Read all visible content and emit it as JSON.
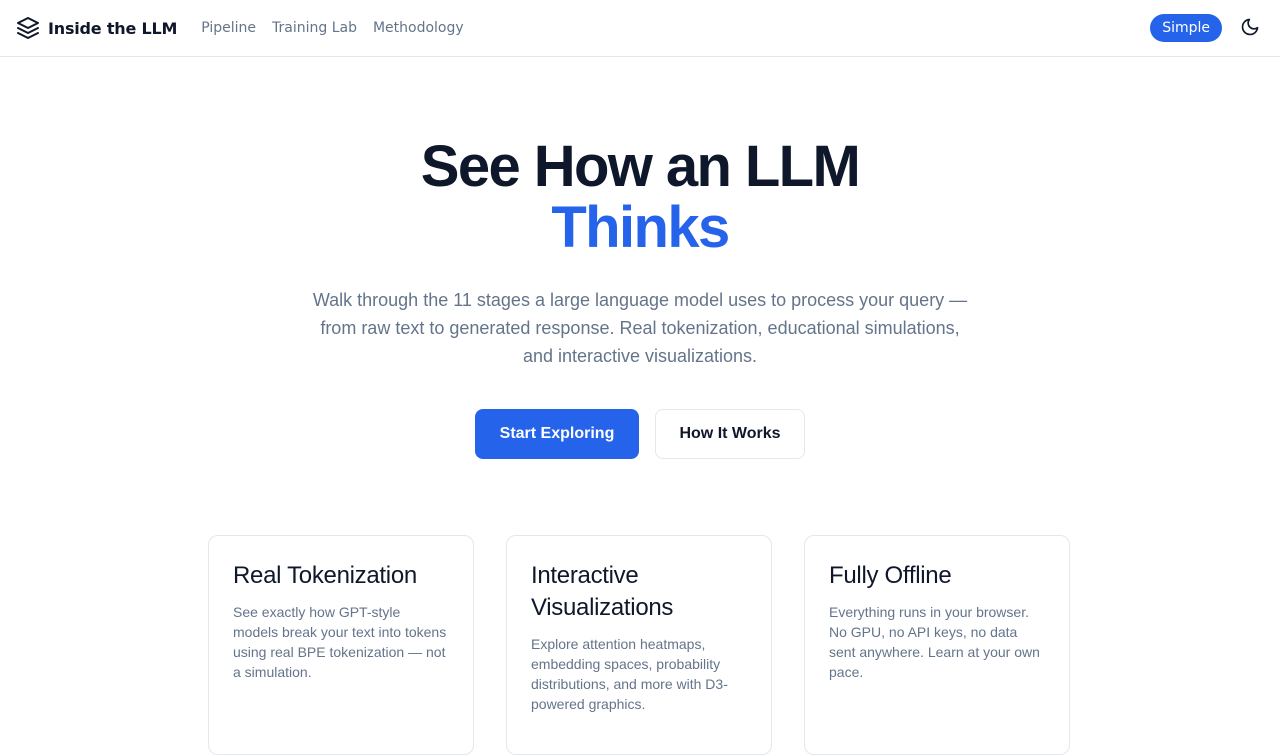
{
  "header": {
    "brand": "Inside the LLM",
    "brand_icon": "layers-icon",
    "nav": [
      {
        "label": "Pipeline"
      },
      {
        "label": "Training Lab"
      },
      {
        "label": "Methodology"
      }
    ],
    "mode_label": "Simple",
    "theme_icon": "moon-icon"
  },
  "hero": {
    "title_line1": "See How an LLM",
    "title_line2": "Thinks",
    "subtitle": "Walk through the 11 stages a large language model uses to process your query — from raw text to generated response. Real tokenization, educational simulations, and interactive visualizations.",
    "primary_cta": "Start Exploring",
    "secondary_cta": "How It Works"
  },
  "features": [
    {
      "title": "Real Tokenization",
      "text": "See exactly how GPT-style models break your text into tokens using real BPE tokenization — not a simulation."
    },
    {
      "title": "Interactive Visualizations",
      "text": "Explore attention heatmaps, embedding spaces, probability distributions, and more with D3-powered graphics."
    },
    {
      "title": "Fully Offline",
      "text": "Everything runs in your browser. No GPU, no API keys, no data sent anywhere. Learn at your own pace."
    }
  ],
  "colors": {
    "accent": "#2563eb",
    "text_primary": "#0f172a",
    "text_muted": "#64748b",
    "border": "#e5e7eb"
  }
}
